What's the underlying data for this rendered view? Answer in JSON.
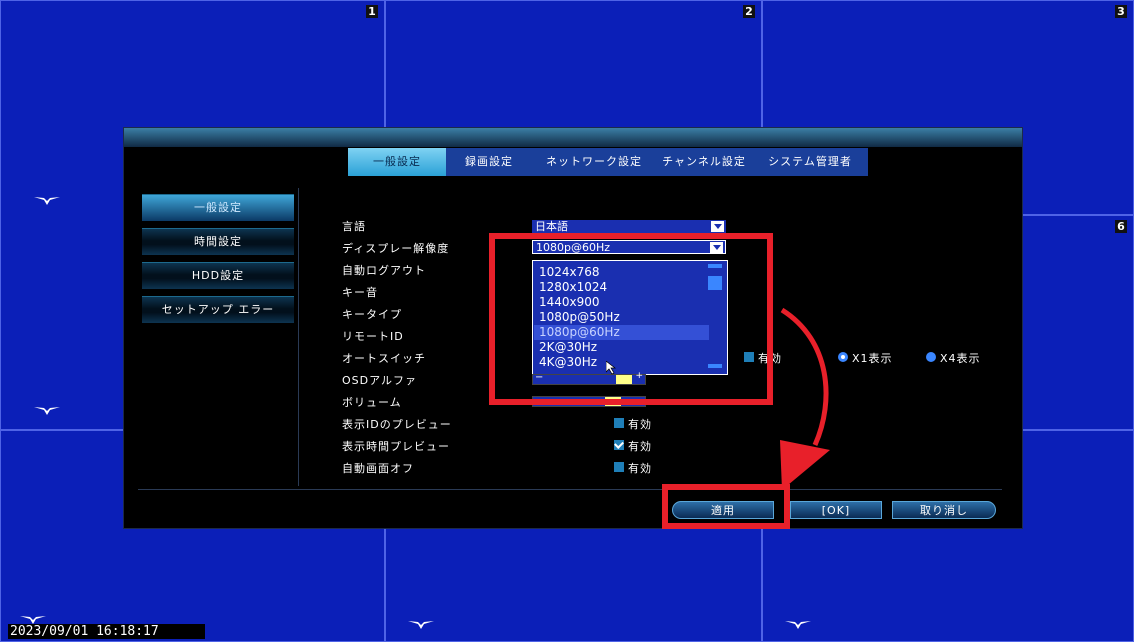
{
  "channels": [
    "1",
    "2",
    "3",
    "6"
  ],
  "timestamp": "2023/09/01 16:18:17",
  "tabs": [
    "一般設定",
    "録画設定",
    "ネットワーク設定",
    "チャンネル設定",
    "システム管理者"
  ],
  "sidebar": [
    "一般設定",
    "時間設定",
    "HDD設定",
    "セットアップ エラー"
  ],
  "form": {
    "labels": [
      "言語",
      "ディスプレー解像度",
      "自動ログアウト",
      "キー音",
      "キータイプ",
      "リモートID",
      "オートスイッチ",
      "OSDアルファ",
      "ボリューム",
      "表示IDのプレビュー",
      "表示時間プレビュー",
      "自動画面オフ"
    ],
    "language_value": "日本語",
    "resolution_value": "1080p@60Hz",
    "resolution_options": [
      "1024x768",
      "1280x1024",
      "1440x900",
      "1080p@50Hz",
      "1080p@60Hz",
      "2K@30Hz",
      "4K@30Hz"
    ],
    "selected_option_index": 4,
    "autoswitch_enable_label": "有効",
    "x1_label": "X1表示",
    "x4_label": "X4表示",
    "preview_id_label": "有効",
    "preview_time_label": "有効",
    "screen_off_label": "有効",
    "osd_alpha_fraction": 0.75,
    "volume_fraction": 0.68
  },
  "buttons": {
    "apply": "適用",
    "ok": "[OK]",
    "cancel": "取り消し"
  },
  "colors": {
    "background": "#0b1fb8",
    "highlight": "#e8202a"
  }
}
